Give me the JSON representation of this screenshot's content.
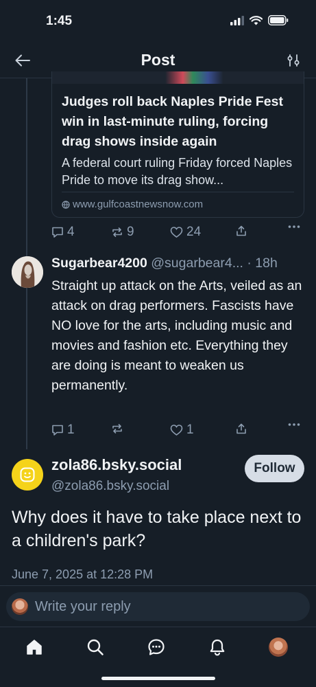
{
  "status_bar": {
    "time": "1:45"
  },
  "header": {
    "title": "Post"
  },
  "link_card": {
    "title": "Judges roll back Naples Pride Fest win in last-minute ruling, forcing drag shows inside again",
    "description": "A federal court ruling Friday forced Naples Pride to move its drag show...",
    "domain": "www.gulfcoastnewsnow.com"
  },
  "parent_actions": {
    "replies": "4",
    "reposts": "9",
    "likes": "24"
  },
  "reply_post": {
    "display_name": "Sugarbear4200",
    "handle": "@sugarbear4...",
    "time": "· 18h",
    "text": "Straight up attack on the Arts, veiled as an attack on drag performers. Fascists have NO love for the arts, including music and movies and fashion etc. Everything they are doing is meant to weaken us permanently.",
    "actions": {
      "replies": "1",
      "reposts": "",
      "likes": "1"
    }
  },
  "main_post": {
    "display_name": "zola86.bsky.social",
    "handle": "@zola86.bsky.social",
    "follow_label": "Follow",
    "text": "Why does it have to take place next to a children's park?",
    "date": "June 7, 2025 at 12:28 PM"
  },
  "composer": {
    "placeholder": "Write your reply"
  },
  "colors": {
    "background": "#161e27",
    "muted": "#8d9db0",
    "accent_avatar": "#f5d31a",
    "follow_bg": "#d6dde6"
  },
  "icons": [
    "back-arrow-icon",
    "sliders-icon",
    "reply-icon",
    "repost-icon",
    "like-icon",
    "share-icon",
    "more-icon",
    "home-icon",
    "search-icon",
    "chat-icon",
    "bell-icon"
  ]
}
